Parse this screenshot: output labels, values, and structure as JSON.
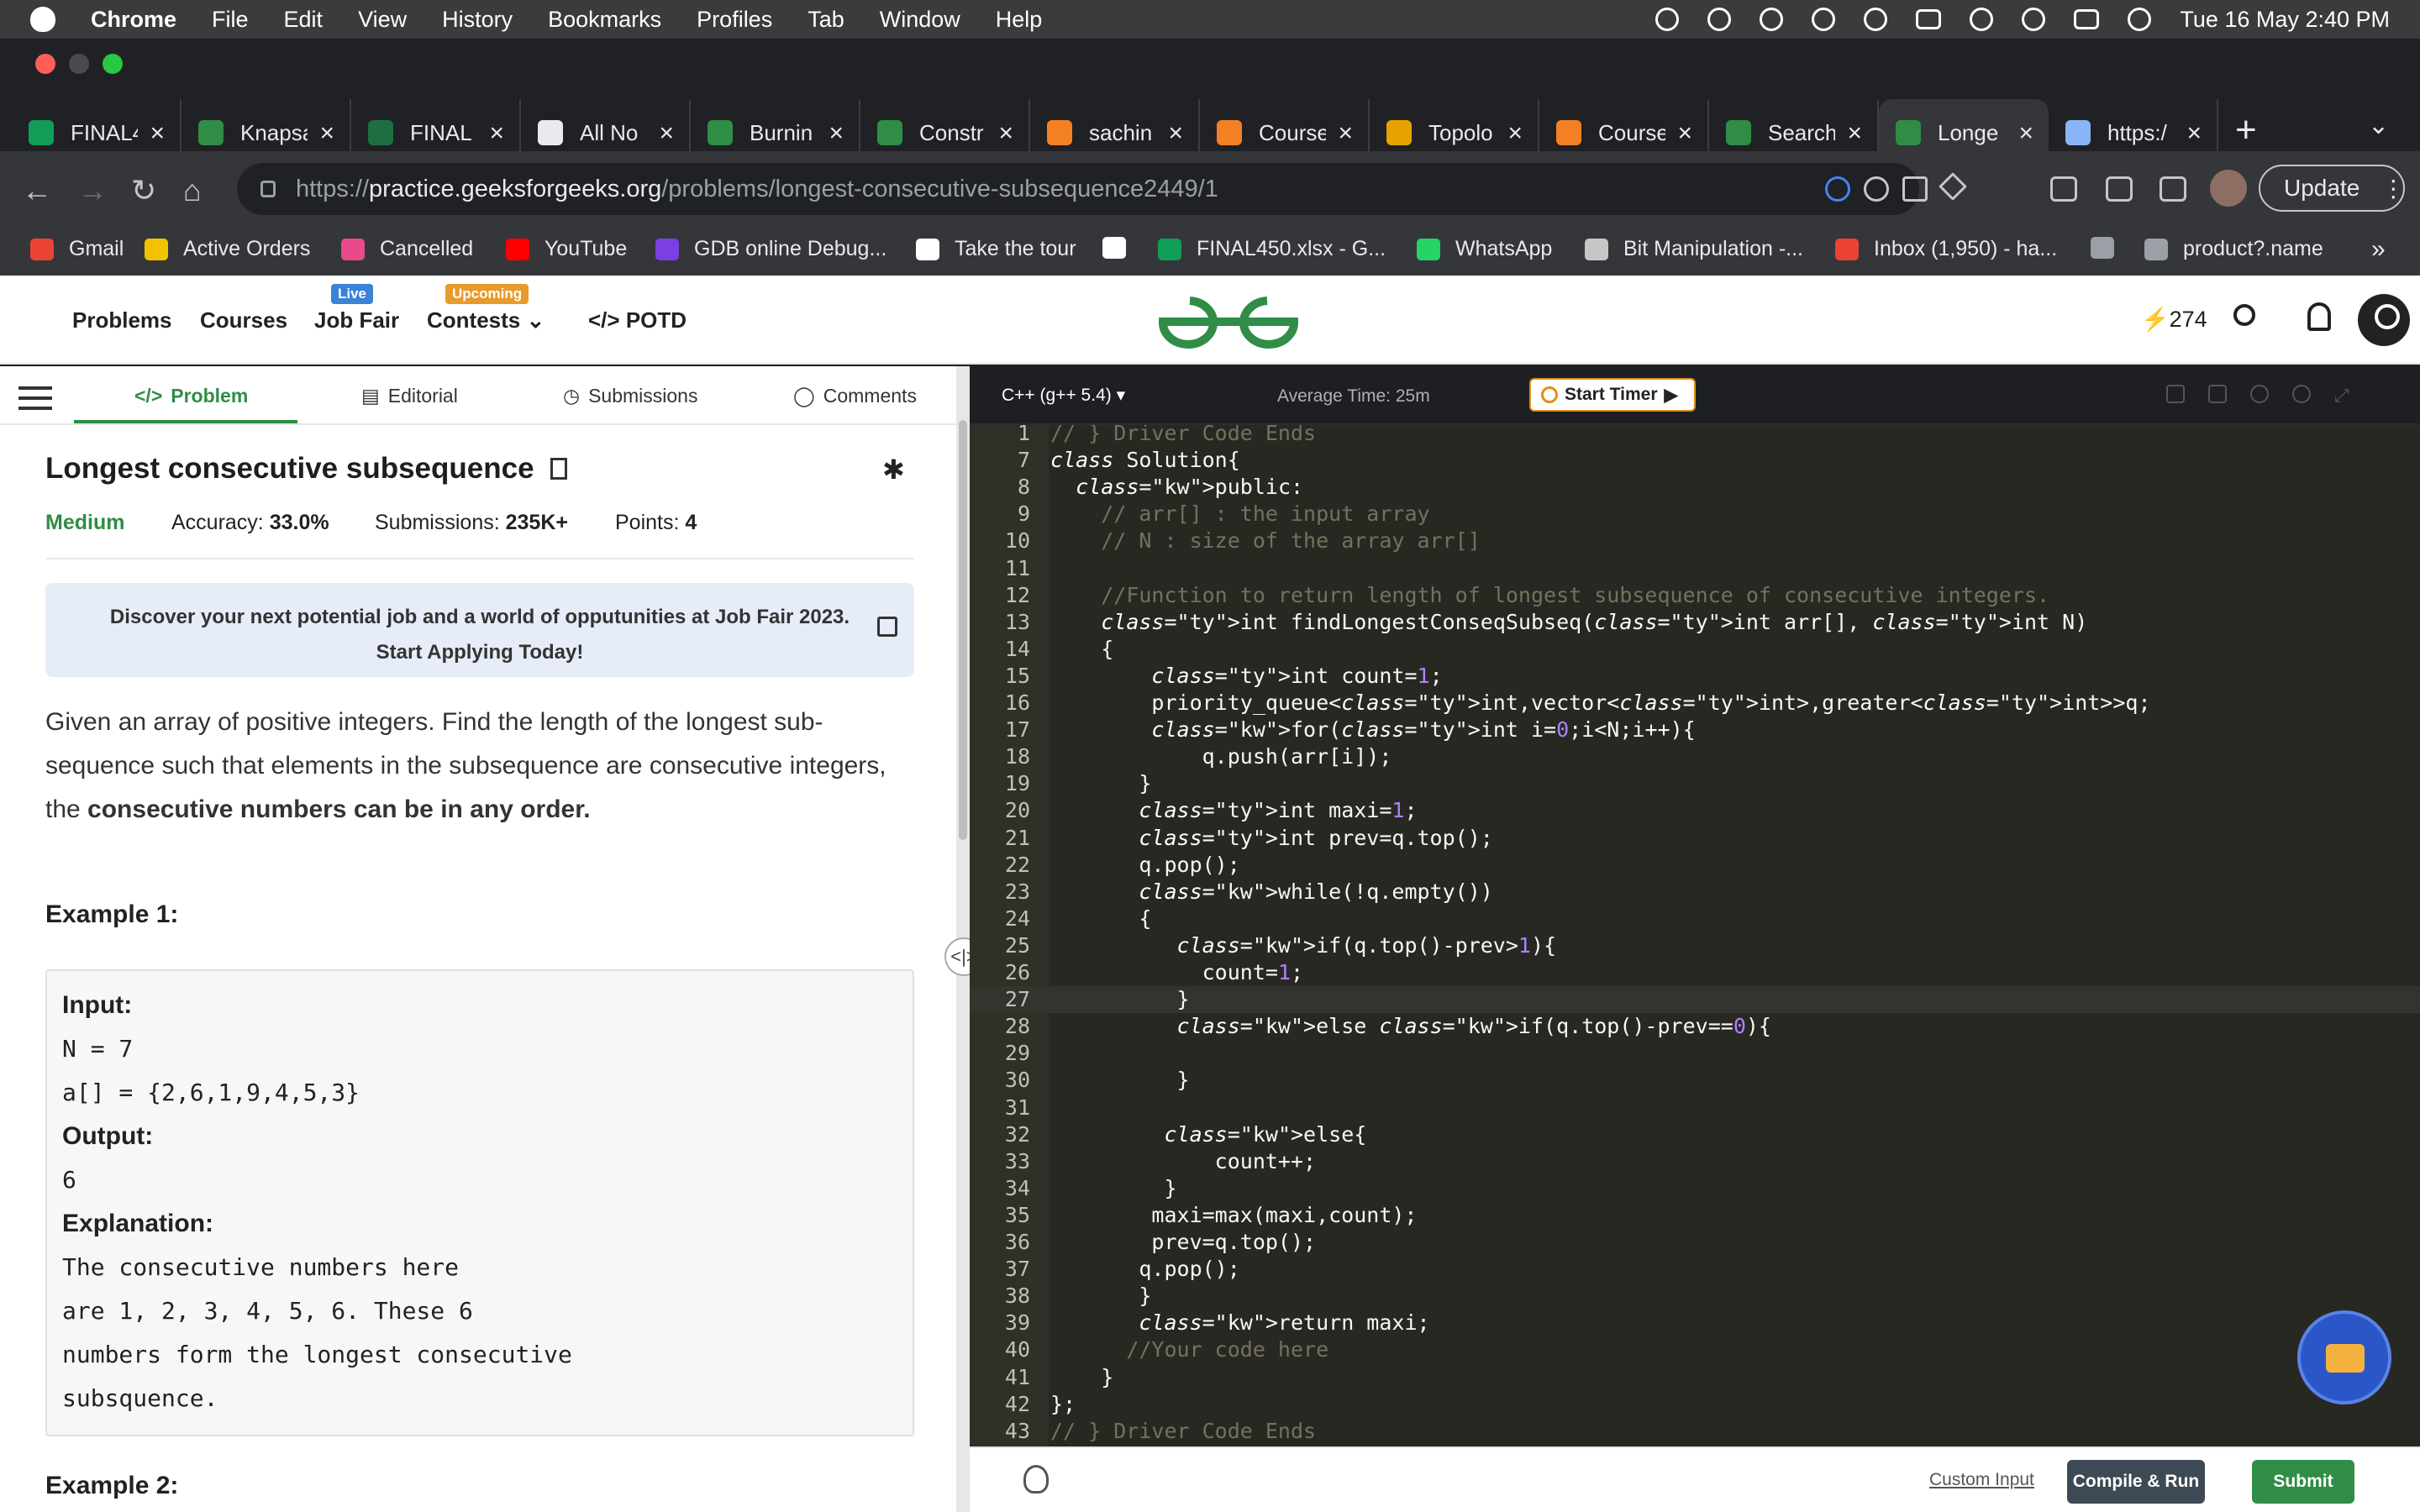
{
  "menubar": {
    "app": "Chrome",
    "items": [
      "File",
      "Edit",
      "View",
      "History",
      "Bookmarks",
      "Profiles",
      "Tab",
      "Window",
      "Help"
    ],
    "clock": "Tue 16 May  2:40 PM"
  },
  "tabs": [
    {
      "label": "FINAL4",
      "color": "#0f9d58"
    },
    {
      "label": "Knapsa",
      "color": "#2f8d46"
    },
    {
      "label": "FINAL",
      "color": "#1d6f42"
    },
    {
      "label": "All No",
      "color": "#e8eaed"
    },
    {
      "label": "Burnin",
      "color": "#2f8d46"
    },
    {
      "label": "Constr",
      "color": "#2f8d46"
    },
    {
      "label": "sachin",
      "color": "#f48024"
    },
    {
      "label": "Course",
      "color": "#f48024"
    },
    {
      "label": "Topolo",
      "color": "#e8a200"
    },
    {
      "label": "Course",
      "color": "#f48024"
    },
    {
      "label": "Search",
      "color": "#2f8d46"
    },
    {
      "label": "Longe",
      "color": "#2f8d46"
    },
    {
      "label": "https:/",
      "color": "#8ab4f8"
    }
  ],
  "url": {
    "scheme": "https://",
    "host": "practice.geeksforgeeks.org",
    "path": "/problems/longest-consecutive-subsequence2449/1"
  },
  "update_label": "Update",
  "bookmarks": [
    {
      "label": "Gmail",
      "color": "#ea4335"
    },
    {
      "label": "Active Orders",
      "color": "#f2c200"
    },
    {
      "label": "Cancelled",
      "color": "#e84a8a"
    },
    {
      "label": "YouTube",
      "color": "#ff0000"
    },
    {
      "label": "GDB online Debug...",
      "color": "#7b3fe4"
    },
    {
      "label": "Take the tour",
      "color": "#ffffff"
    },
    {
      "label": "",
      "color": "#ffffff"
    },
    {
      "label": "FINAL450.xlsx - G...",
      "color": "#0f9d58"
    },
    {
      "label": "WhatsApp",
      "color": "#25d366"
    },
    {
      "label": "Bit Manipulation -...",
      "color": "#c4c7c5"
    },
    {
      "label": "Inbox (1,950) - ha...",
      "color": "#ea4335"
    },
    {
      "label": "",
      "color": "#9aa0a6"
    },
    {
      "label": "product?.name",
      "color": "#9aa0a6"
    }
  ],
  "sitenav": {
    "problems": "Problems",
    "courses": "Courses",
    "jobfair": "Job Fair",
    "live": "Live",
    "contests": "Contests",
    "upcoming": "Upcoming",
    "potd": "POTD",
    "streak": "274"
  },
  "ptabs": {
    "problem": "Problem",
    "editorial": "Editorial",
    "submissions": "Submissions",
    "comments": "Comments"
  },
  "problem": {
    "title": "Longest consecutive subsequence",
    "difficulty": "Medium",
    "accuracy_label": "Accuracy:",
    "accuracy": "33.0%",
    "submissions_label": "Submissions:",
    "submissions": "235K+",
    "points_label": "Points:",
    "points": "4",
    "promo": "Discover your next potential job and a world of opputunities at Job Fair 2023. Start Applying Today!",
    "desc_a": "Given an array of positive integers. Find the length of the longest sub-sequence such that elements in the subsequence are consecutive integers, the ",
    "desc_b": "consecutive numbers can be in any order.",
    "example1": "Example 1:",
    "example2": "Example 2:",
    "ex_lines": [
      "Input:",
      "N = 7",
      "a[] = {2,6,1,9,4,5,3}",
      "Output:",
      "6",
      "Explanation:",
      "The consecutive numbers here",
      "are 1, 2, 3, 4, 5, 6. These 6",
      "numbers form the longest consecutive",
      "subsquence."
    ]
  },
  "editor": {
    "language": "C++ (g++ 5.4)",
    "avg_time": "Average Time: 25m",
    "timer": "Start Timer",
    "custom_input": "Custom Input",
    "compile": "Compile & Run",
    "submit": "Submit"
  },
  "code": [
    {
      "n": "1",
      "t": "// } Driver Code Ends"
    },
    {
      "n": "7",
      "t": "class Solution{"
    },
    {
      "n": "8",
      "t": "  public:"
    },
    {
      "n": "9",
      "t": "    // arr[] : the input array"
    },
    {
      "n": "10",
      "t": "    // N : size of the array arr[]"
    },
    {
      "n": "11",
      "t": ""
    },
    {
      "n": "12",
      "t": "    //Function to return length of longest subsequence of consecutive integers."
    },
    {
      "n": "13",
      "t": "    int findLongestConseqSubseq(int arr[], int N)"
    },
    {
      "n": "14",
      "t": "    {"
    },
    {
      "n": "15",
      "t": "        int count=1;"
    },
    {
      "n": "16",
      "t": "        priority_queue<int,vector<int>,greater<int>>q;"
    },
    {
      "n": "17",
      "t": "        for(int i=0;i<N;i++){"
    },
    {
      "n": "18",
      "t": "            q.push(arr[i]);"
    },
    {
      "n": "19",
      "t": "       }"
    },
    {
      "n": "20",
      "t": "       int maxi=1;"
    },
    {
      "n": "21",
      "t": "       int prev=q.top();"
    },
    {
      "n": "22",
      "t": "       q.pop();"
    },
    {
      "n": "23",
      "t": "       while(!q.empty())"
    },
    {
      "n": "24",
      "t": "       {"
    },
    {
      "n": "25",
      "t": "          if(q.top()-prev>1){"
    },
    {
      "n": "26",
      "t": "            count=1;"
    },
    {
      "n": "27",
      "t": "          }"
    },
    {
      "n": "28",
      "t": "          else if(q.top()-prev==0){"
    },
    {
      "n": "29",
      "t": ""
    },
    {
      "n": "30",
      "t": "          }"
    },
    {
      "n": "31",
      "t": ""
    },
    {
      "n": "32",
      "t": "         else{"
    },
    {
      "n": "33",
      "t": "             count++;"
    },
    {
      "n": "34",
      "t": "         }"
    },
    {
      "n": "35",
      "t": "        maxi=max(maxi,count);"
    },
    {
      "n": "36",
      "t": "        prev=q.top();"
    },
    {
      "n": "37",
      "t": "       q.pop();"
    },
    {
      "n": "38",
      "t": "       }"
    },
    {
      "n": "39",
      "t": "       return maxi;"
    },
    {
      "n": "40",
      "t": "      //Your code here"
    },
    {
      "n": "41",
      "t": "    }"
    },
    {
      "n": "42",
      "t": "};"
    },
    {
      "n": "43",
      "t": "// } Driver Code Ends"
    }
  ]
}
